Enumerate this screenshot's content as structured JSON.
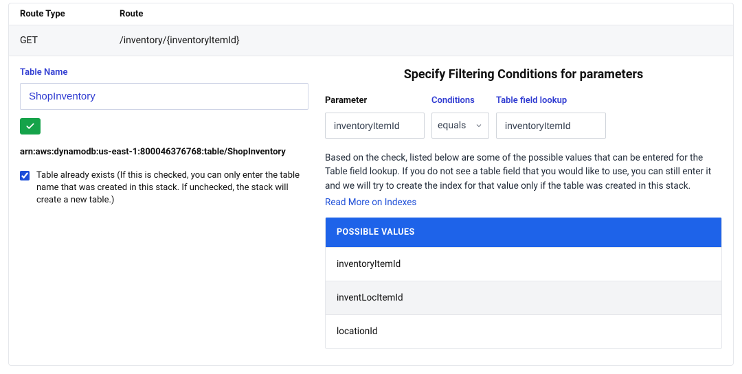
{
  "header": {
    "route_type_label": "Route Type",
    "route_label": "Route",
    "route_type": "GET",
    "route": "/inventory/{inventoryItemId}"
  },
  "left": {
    "table_name_label": "Table Name",
    "table_name_value": "ShopInventory",
    "arn": "arn:aws:dynamodb:us-east-1:800046376768:table/ShopInventory",
    "table_exists_checked": true,
    "table_exists_label": "Table already exists (If this is checked, you can only enter the table name that was created in this stack. If unchecked, the stack will create a new table.)"
  },
  "right": {
    "title": "Specify Filtering Conditions for parameters",
    "parameter_label": "Parameter",
    "conditions_label": "Conditions",
    "lookup_label": "Table field lookup",
    "parameter_value": "inventoryItemId",
    "condition_value": "equals",
    "lookup_value": "inventoryItemId",
    "help_text": "Based on the check, listed below are some of the possible values that can be entered for the Table field lookup. If you do not see a table field that you would like to use, you can still enter it and we will try to create the index for that value only if the table was created in this stack.",
    "link_text": "Read More on Indexes",
    "possible_values_header": "Possible Values",
    "possible_values": [
      "inventoryItemId",
      "inventLocItemId",
      "locationId"
    ]
  }
}
